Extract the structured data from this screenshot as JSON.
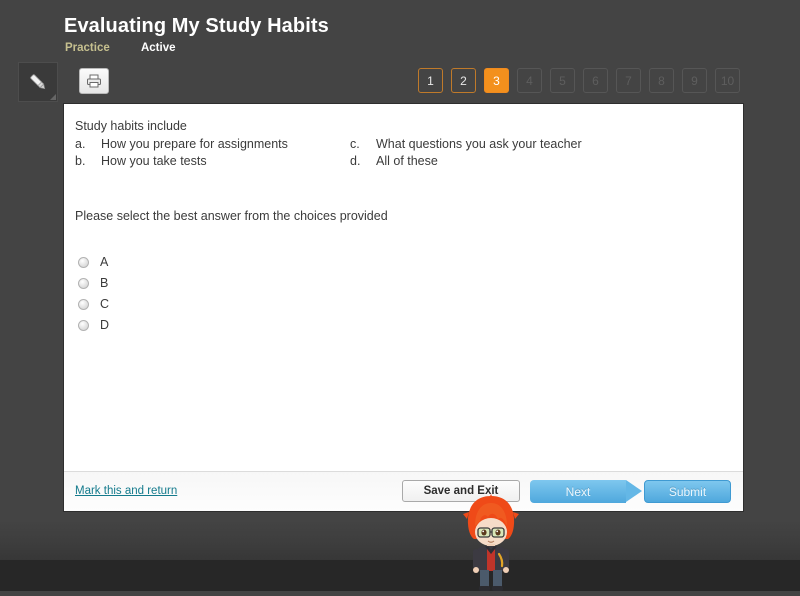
{
  "header": {
    "title": "Evaluating My Study Habits",
    "mode": "Practice",
    "status": "Active",
    "tools": [
      {
        "name": "pencil-tool-button",
        "icon": "pencil-icon"
      },
      {
        "name": "print-button",
        "icon": "printer-icon"
      }
    ]
  },
  "question_nav": {
    "buttons": [
      {
        "label": "1",
        "state": "visited"
      },
      {
        "label": "2",
        "state": "visited"
      },
      {
        "label": "3",
        "state": "current"
      },
      {
        "label": "4",
        "state": "locked"
      },
      {
        "label": "5",
        "state": "locked"
      },
      {
        "label": "6",
        "state": "locked"
      },
      {
        "label": "7",
        "state": "locked"
      },
      {
        "label": "8",
        "state": "locked"
      },
      {
        "label": "9",
        "state": "locked"
      },
      {
        "label": "10",
        "state": "locked"
      }
    ],
    "current": "3",
    "total": "10"
  },
  "question": {
    "stem": "Study habits include",
    "choices": [
      {
        "letter": "a.",
        "text": "How you prepare for assignments"
      },
      {
        "letter": "b.",
        "text": "How you take tests"
      },
      {
        "letter": "c.",
        "text": "What questions you ask your teacher"
      },
      {
        "letter": "d.",
        "text": "All of these"
      }
    ],
    "instruction": "Please select the best answer from the choices provided",
    "answers": [
      {
        "label": "A",
        "selected": false
      },
      {
        "label": "B",
        "selected": false
      },
      {
        "label": "C",
        "selected": false
      },
      {
        "label": "D",
        "selected": false
      }
    ]
  },
  "footer": {
    "mark_link": "Mark this and return",
    "save_button": "Save and Exit",
    "next_button": "Next",
    "submit_button": "Submit"
  },
  "colors": {
    "page_background": "#444444",
    "bottom_band": "#272727",
    "accent_orange": "#f3901d",
    "visited_border": "#c07a2a",
    "mode_label": "#c6c08f",
    "link_teal": "#137a8c",
    "button_blue": "#4fa8dd",
    "card_background": "#ffffff"
  },
  "overlay": {
    "character": "chibi-avatar"
  }
}
